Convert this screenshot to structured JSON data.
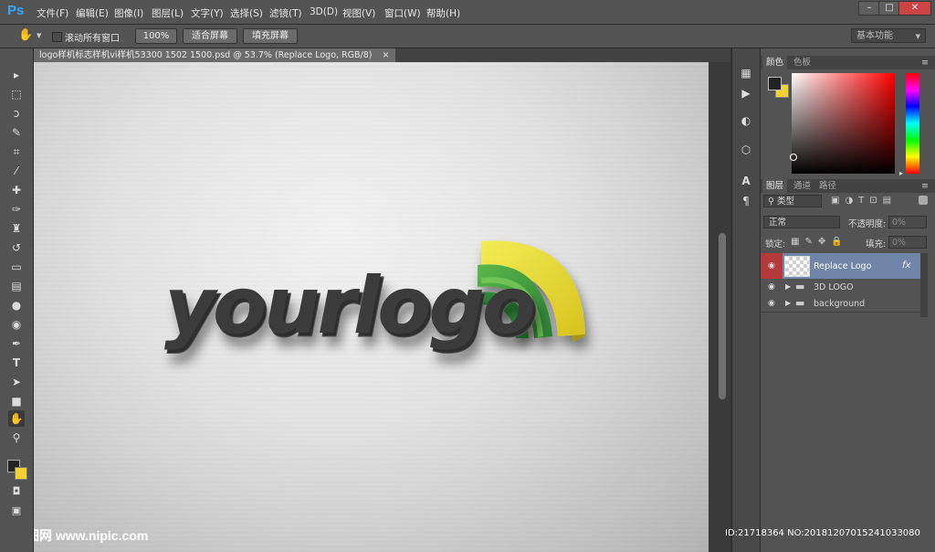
{
  "app": {
    "logo": "Ps"
  },
  "menu": [
    "文件(F)",
    "编辑(E)",
    "图像(I)",
    "图层(L)",
    "文字(Y)",
    "选择(S)",
    "滤镜(T)",
    "3D(D)",
    "视图(V)",
    "窗口(W)",
    "帮助(H)"
  ],
  "window_controls": {
    "minimize": "–",
    "maximize": "□",
    "close": "✕"
  },
  "options_bar": {
    "scroll_all_label": "滚动所有窗口",
    "zoom_100": "100%",
    "fit_screen": "适合屏幕",
    "fill_screen": "填充屏幕",
    "workspace": "基本功能"
  },
  "document": {
    "tab_title": "logo样机标志样机vi样机53300 1502 1500.psd @ 53.7% (Replace Logo, RGB/8)",
    "tab_close": "×",
    "logo_text": "yourlogo"
  },
  "colors": {
    "accent": "#31a8ff",
    "foreground": "#222222",
    "background": "#f2d230",
    "layer_selected": "#6f86a8",
    "eye_column_selected": "#b43a3a",
    "logo_yellow": "#e8df2a",
    "logo_green": "#3b9c3e"
  },
  "color_panel": {
    "tabs": [
      "颜色",
      "色板"
    ]
  },
  "layers_panel": {
    "tabs": [
      "图层",
      "通道",
      "路径"
    ],
    "filter_kind": "类型",
    "blend_mode": "正常",
    "opacity_label": "不透明度:",
    "opacity_value": "0%",
    "lock_label": "锁定:",
    "fill_label": "填充:",
    "fill_value": "0%",
    "layers": [
      {
        "name": "Replace Logo",
        "fx": "fx",
        "selected": true
      },
      {
        "name": "3D LOGO",
        "type": "group"
      },
      {
        "name": "background",
        "type": "group"
      }
    ]
  },
  "watermark": {
    "site": "昵图网 www.nipic.com",
    "id_text": "ID:21718364 NO:20181207015241033080"
  }
}
